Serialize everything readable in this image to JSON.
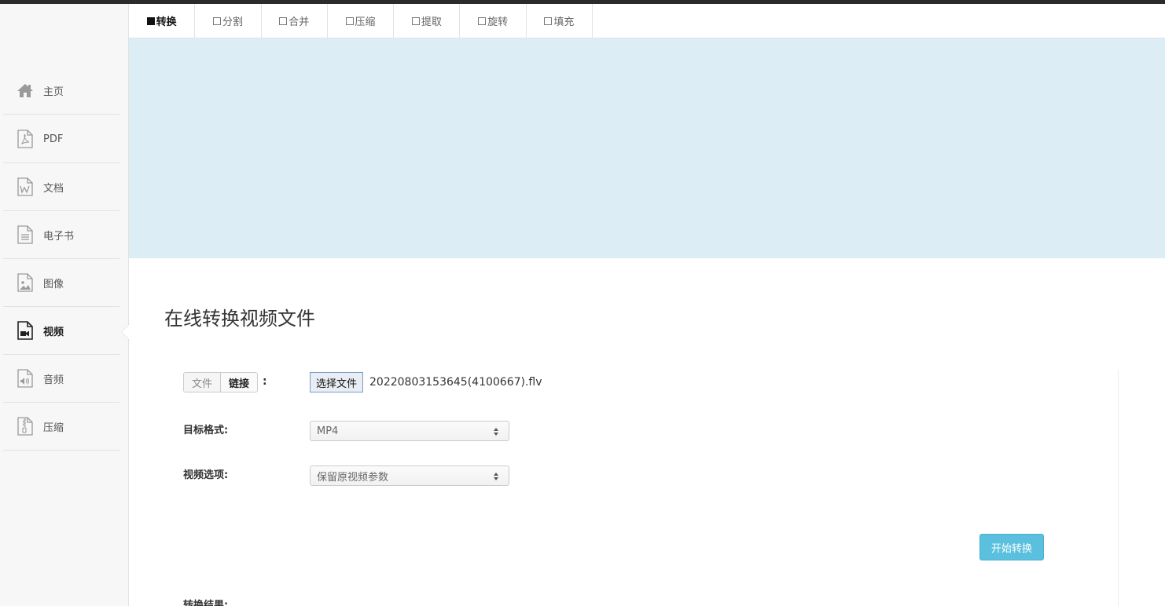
{
  "tabs": [
    {
      "label": "转换",
      "active": true
    },
    {
      "label": "分割",
      "active": false
    },
    {
      "label": "合并",
      "active": false
    },
    {
      "label": "压缩",
      "active": false
    },
    {
      "label": "提取",
      "active": false
    },
    {
      "label": "旋转",
      "active": false
    },
    {
      "label": "填充",
      "active": false
    }
  ],
  "sidebar": {
    "items": [
      {
        "label": "主页",
        "icon": "home-icon"
      },
      {
        "label": "PDF",
        "icon": "pdf-file-icon"
      },
      {
        "label": "文档",
        "icon": "word-file-icon"
      },
      {
        "label": "电子书",
        "icon": "ebook-file-icon"
      },
      {
        "label": "图像",
        "icon": "image-file-icon"
      },
      {
        "label": "视频",
        "icon": "video-file-icon",
        "active": true
      },
      {
        "label": "音频",
        "icon": "audio-file-icon"
      },
      {
        "label": "压缩",
        "icon": "archive-file-icon"
      }
    ]
  },
  "main": {
    "title": "在线转换视频文件",
    "source_toggle": {
      "file": "文件",
      "link": "链接",
      "selected": "链接",
      "colon": ":"
    },
    "file_button": "选择文件",
    "file_name": "20220803153645(4100667).flv",
    "target_format": {
      "label": "目标格式:",
      "value": "MP4"
    },
    "video_options": {
      "label": "视频选项:",
      "value": "保留原视频参数"
    },
    "start_button": "开始转换",
    "result_label": "转换结果:"
  },
  "colors": {
    "banner": "#dcedf6",
    "accent_button": "#5bc0de",
    "sidebar_bg": "#f7f7f7"
  }
}
